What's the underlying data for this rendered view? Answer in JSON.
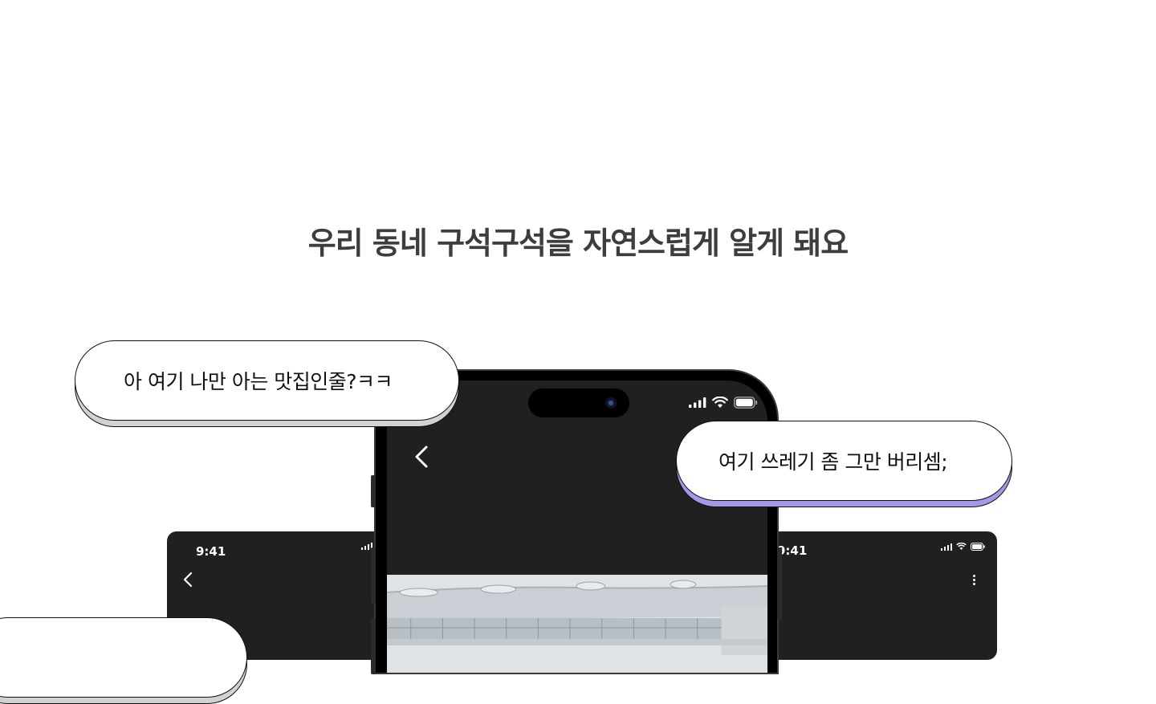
{
  "headline": "우리 동네 구석구석을 자연스럽게 알게 돼요",
  "left_phone": {
    "time": "9:41"
  },
  "right_phone": {
    "time": "9:41"
  },
  "bubbles": {
    "top_left": "아 여기 나만 아는 맛집인줄?ㅋㅋ",
    "right": "여기 쓰레기 좀 그만 버리셈;",
    "bottom_left": ""
  },
  "colors": {
    "headline": "#3d3d3d",
    "phone_screen": "#202020",
    "bubble_shadow_gray": "#d2d2d2",
    "bubble_shadow_purple": "#a896e8"
  },
  "icons": [
    "back-chevron-icon",
    "signal-icon",
    "wifi-icon",
    "battery-icon",
    "more-vert-icon",
    "camera-icon"
  ]
}
